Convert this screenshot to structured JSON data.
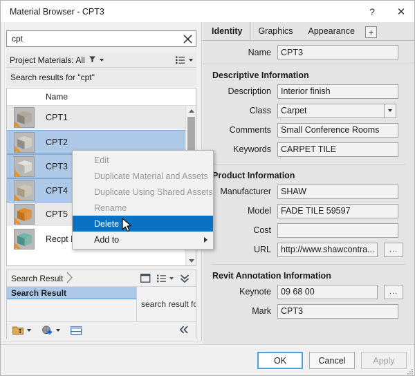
{
  "window": {
    "title": "Material Browser - CPT3",
    "help_label": "?",
    "close_label": "✕"
  },
  "search": {
    "value": "cpt",
    "placeholder": "",
    "clear_icon": "clear-icon"
  },
  "filter": {
    "label": "Project Materials: All",
    "funnel_icon": "funnel-icon",
    "view_icon": "list-view-icon"
  },
  "results_header": "Search results for \"cpt\"",
  "list": {
    "columns": [
      "",
      "Name"
    ],
    "name_column": "Name",
    "rows": [
      {
        "name": "CPT1",
        "selected": false,
        "swatch": "#b0a79b",
        "swatch2": "#8a8179"
      },
      {
        "name": "CPT2",
        "selected": true,
        "swatch": "#d6d2c6",
        "swatch2": "#8f8d85"
      },
      {
        "name": "CPT3",
        "selected": true,
        "swatch": "#e2e0d8",
        "swatch2": "#b6b4ac"
      },
      {
        "name": "CPT4",
        "selected": true,
        "swatch": "#cfc6b4",
        "swatch2": "#a89a84"
      },
      {
        "name": "CPT5",
        "selected": false,
        "swatch": "#e08a2a",
        "swatch2": "#c0721c"
      },
      {
        "name": "Recpt Desk – Art Glass",
        "selected": false,
        "swatch": "#6fb5ab",
        "swatch2": "#4e8f87"
      }
    ]
  },
  "context_menu": {
    "items": [
      {
        "label": "Edit",
        "enabled": false,
        "highlighted": false,
        "submenu": false
      },
      {
        "label": "Duplicate Material and Assets",
        "enabled": false,
        "highlighted": false,
        "submenu": false
      },
      {
        "label": "Duplicate Using Shared Assets",
        "enabled": false,
        "highlighted": false,
        "submenu": false
      },
      {
        "label": "Rename",
        "enabled": false,
        "highlighted": false,
        "submenu": false
      },
      {
        "label": "Delete",
        "enabled": true,
        "highlighted": true,
        "submenu": false
      },
      {
        "label": "Add to",
        "enabled": true,
        "highlighted": false,
        "submenu": true
      }
    ]
  },
  "search_result_panel": {
    "breadcrumb": "Search Result",
    "tree_node": "Search Result",
    "detail_text": "search result for \"c",
    "header_icons": [
      "panel-icon",
      "list-view-icon",
      "chevron-double-down-icon"
    ],
    "footer_icons": [
      "new-library-icon",
      "new-asset-icon",
      "panel-toggle-icon"
    ],
    "collapse_icon": "chevron-double-left-icon"
  },
  "left_footer": {
    "icon": "edit-material-icon"
  },
  "right_panel": {
    "tabs": [
      {
        "label": "Identity",
        "active": true
      },
      {
        "label": "Graphics",
        "active": false
      },
      {
        "label": "Appearance",
        "active": false
      }
    ],
    "add_tab_label": "+",
    "name_label": "Name",
    "name_value": "CPT3",
    "sections": [
      {
        "title": "Descriptive Information",
        "fields": [
          {
            "label": "Description",
            "value": "Interior finish",
            "type": "text"
          },
          {
            "label": "Class",
            "value": "Carpet",
            "type": "dropdown"
          },
          {
            "label": "Comments",
            "value": "Small Conference Rooms",
            "type": "text"
          },
          {
            "label": "Keywords",
            "value": "CARPET TILE",
            "type": "text"
          }
        ]
      },
      {
        "title": "Product Information",
        "fields": [
          {
            "label": "Manufacturer",
            "value": "SHAW",
            "type": "text"
          },
          {
            "label": "Model",
            "value": "FADE TILE 59597",
            "type": "text"
          },
          {
            "label": "Cost",
            "value": "",
            "type": "text"
          },
          {
            "label": "URL",
            "value": "http://www.shawcontra...",
            "type": "browse",
            "browse_label": "..."
          }
        ]
      },
      {
        "title": "Revit Annotation Information",
        "fields": [
          {
            "label": "Keynote",
            "value": "09 68 00",
            "type": "browse",
            "browse_label": "..."
          },
          {
            "label": "Mark",
            "value": "CPT3",
            "type": "text"
          }
        ]
      }
    ]
  },
  "buttons": {
    "ok": "OK",
    "cancel": "Cancel",
    "apply": "Apply"
  },
  "colors": {
    "selection_blue": "#aec8e8",
    "menu_highlight": "#0a72c4",
    "default_button_border": "#4aa3e0",
    "warning_orange": "#e8911e"
  }
}
